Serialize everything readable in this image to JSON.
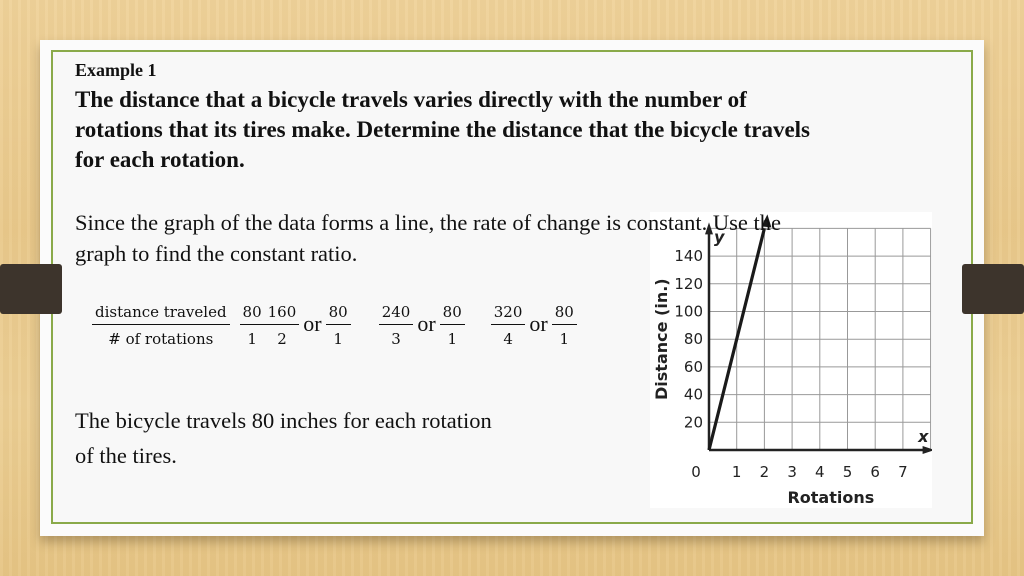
{
  "slide": {
    "example_label": "Example 1",
    "problem": "The distance that a bicycle travels varies directly with the number of rotations that its tires make. Determine the distance that the bicycle travels for each rotation.",
    "explanation": "Since the graph of the data forms a line, the rate of change is constant. Use the graph to find the constant ratio.",
    "ratio_expression": {
      "lead": {
        "num": "distance traveled",
        "den": "# of rotations"
      },
      "fractions": [
        {
          "num": "80",
          "den": "1"
        },
        {
          "num": "160",
          "den": "2"
        },
        {
          "connector": "or"
        },
        {
          "num": "80",
          "den": "1"
        },
        {
          "num": "240",
          "den": "3"
        },
        {
          "connector": "or"
        },
        {
          "num": "80",
          "den": "1"
        },
        {
          "num": "320",
          "den": "4"
        },
        {
          "connector": "or"
        },
        {
          "num": "80",
          "den": "1"
        }
      ]
    },
    "conclusion": "The bicycle travels 80 inches for each rotation of the tires."
  },
  "colors": {
    "background_wood": "#ecce93",
    "slide": "#fbfbfb",
    "border_accent": "#8aaa4a",
    "tab": "#3d342c",
    "text": "#111111"
  },
  "chart_data": {
    "type": "line",
    "title": "",
    "xlabel": "Rotations",
    "ylabel": "Distance (in.)",
    "x_axis_var": "x",
    "y_axis_var": "y",
    "xlim": [
      0,
      8
    ],
    "ylim": [
      0,
      160
    ],
    "x_ticks": [
      "0",
      "1",
      "2",
      "3",
      "4",
      "5",
      "6",
      "7"
    ],
    "y_ticks": [
      "20",
      "40",
      "60",
      "80",
      "100",
      "120",
      "140"
    ],
    "grid": true,
    "series": [
      {
        "name": "distance",
        "x": [
          0,
          1,
          2
        ],
        "y": [
          0,
          80,
          160
        ]
      }
    ]
  }
}
